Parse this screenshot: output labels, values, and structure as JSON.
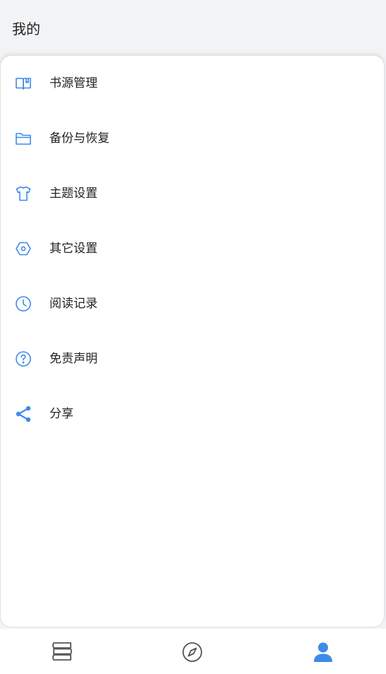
{
  "header": {
    "title": "我的"
  },
  "colors": {
    "accent": "#3d8bea",
    "inactive": "#555555",
    "text": "#222222"
  },
  "menu": {
    "items": [
      {
        "label": "书源管理",
        "icon": "book-icon"
      },
      {
        "label": "备份与恢复",
        "icon": "folder-icon"
      },
      {
        "label": "主题设置",
        "icon": "tshirt-icon"
      },
      {
        "label": "其它设置",
        "icon": "hexagon-settings-icon"
      },
      {
        "label": "阅读记录",
        "icon": "clock-icon"
      },
      {
        "label": "免责声明",
        "icon": "question-circle-icon"
      },
      {
        "label": "分享",
        "icon": "share-icon"
      }
    ]
  },
  "tabbar": {
    "tabs": [
      {
        "icon": "bookshelf-icon",
        "active": false
      },
      {
        "icon": "compass-icon",
        "active": false
      },
      {
        "icon": "user-icon",
        "active": true
      }
    ]
  }
}
